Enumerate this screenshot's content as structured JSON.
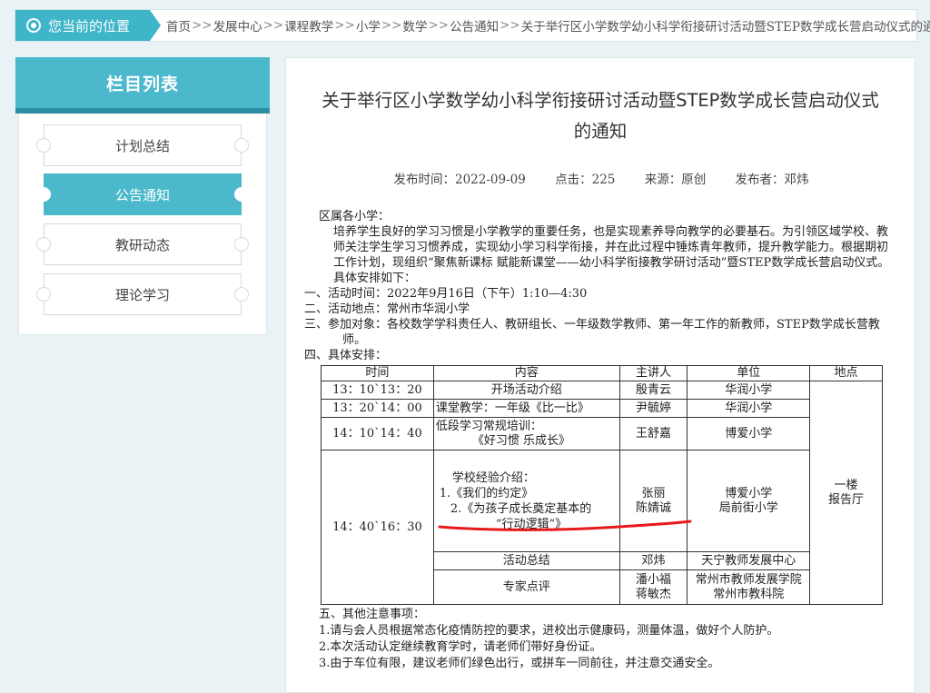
{
  "breadcrumb": {
    "label": "您当前的位置",
    "items": [
      "首页",
      "发展中心",
      "课程教学",
      "小学",
      "数学",
      "公告通知",
      "关于举行区小学数学幼小科学衔接研讨活动暨STEP数学成长营启动仪式的通知"
    ],
    "separator": ">>"
  },
  "sidebar": {
    "title": "栏目列表",
    "items": [
      {
        "label": "计划总结"
      },
      {
        "label": "公告通知"
      },
      {
        "label": "教研动态"
      },
      {
        "label": "理论学习"
      }
    ]
  },
  "article": {
    "title_line1": "关于举行区小学数学幼小科学衔接研讨活动暨STEP数学成长营启动仪式",
    "title_line2": "的通知",
    "meta": {
      "date": "发布时间：2022-09-09",
      "clicks": "点击：225",
      "source": "来源：原创",
      "author": "发布者：邓炜"
    },
    "greeting": "区属各小学：",
    "intro": "培养学生良好的学习习惯是小学教学的重要任务，也是实现素养导向教学的必要基石。为引领区域学校、教师关注学生学习习惯养成，实现幼小学习科学衔接，并在此过程中锤炼青年教师，提升教学能力。根据期初工作计划，现组织“聚焦新课标 赋能新课堂——幼小科学衔接教学研讨活动”暨STEP数学成长营启动仪式。具体安排如下：",
    "item1": "一、活动时间：2022年9月16日（下午）1:10—4:30",
    "item2": "二、活动地点：常州市华润小学",
    "item3": "三、参加对象：各校数学学科责任人、教研组长、一年级数学教师、第一年工作的新教师，STEP数学成长营教师。",
    "item4": "四、具体安排：",
    "table": {
      "headers": [
        "时间",
        "内容",
        "主讲人",
        "单位",
        "地点"
      ],
      "r1": {
        "time": "13：10`13：20",
        "content": "开场活动介绍",
        "speaker": "殷青云",
        "unit": "华润小学"
      },
      "r2": {
        "time": "13：20`14：00",
        "content": "课堂教学：一年级《比一比》",
        "speaker": "尹毓婷",
        "unit": "华润小学"
      },
      "r3": {
        "time": "14：10`14：40",
        "content_a": "低段学习常规培训：",
        "content_b": "《好习惯 乐成长》",
        "speaker": "王舒嘉",
        "unit": "博爱小学"
      },
      "r4": {
        "time": "14：40`16：30",
        "c1": "学校经验介绍：",
        "c2": "1.《我们的约定》",
        "c3": "2.《为孩子成长奠定基本的",
        "c4": "“行动逻辑”》",
        "speaker_a": "张丽",
        "speaker_b": "陈婧诚",
        "unit_a": "博爱小学",
        "unit_b": "局前街小学"
      },
      "r5": {
        "content": "活动总结",
        "speaker": "邓炜",
        "unit": "天宁教师发展中心"
      },
      "r6": {
        "content": "专家点评",
        "speaker_a": "潘小福",
        "speaker_b": "蒋敏杰",
        "unit_a": "常州市教师发展学院",
        "unit_b": "常州市教科院"
      },
      "location_a": "一楼",
      "location_b": "报告厅"
    },
    "item5": "五、其他注意事项：",
    "notes": [
      "1.请与会人员根据常态化疫情防控的要求，进校出示健康码，测量体温，做好个人防护。",
      "2.本次活动认定继续教育学时，请老师们带好身份证。",
      "3.由于车位有限，建议老师们绿色出行，或拼车一同前往，并注意交通安全。"
    ]
  },
  "colors": {
    "accent": "#4bb9cb",
    "annotation": "#e8191d"
  }
}
